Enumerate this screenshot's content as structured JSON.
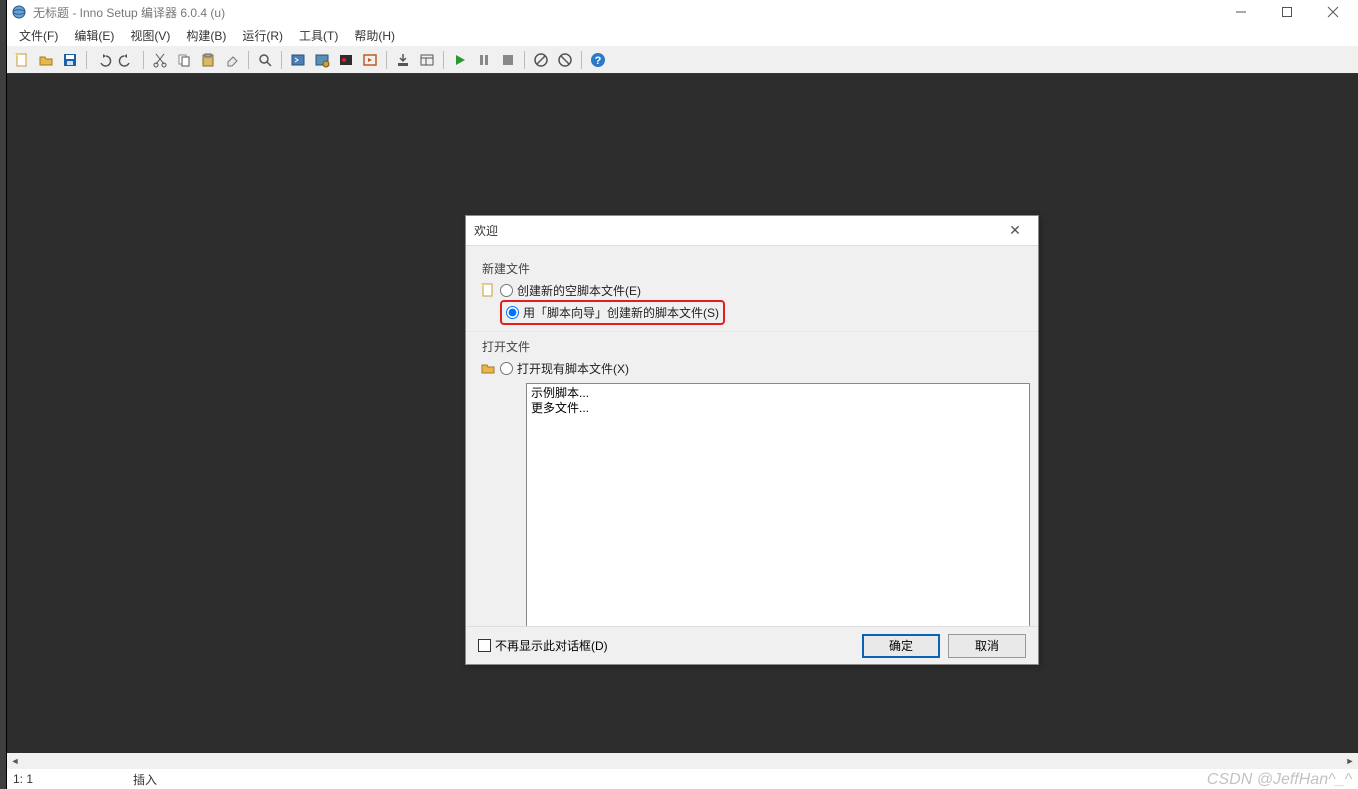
{
  "window": {
    "title": "无标题 - Inno Setup 编译器 6.0.4 (u)"
  },
  "menu": {
    "file": "文件(F)",
    "edit": "编辑(E)",
    "view": "视图(V)",
    "build": "构建(B)",
    "run": "运行(R)",
    "tools": "工具(T)",
    "help": "帮助(H)"
  },
  "status": {
    "position": "1:   1",
    "mode": "插入",
    "watermark": "CSDN @JeffHan^_^"
  },
  "dialog": {
    "title": "欢迎",
    "new_group": "新建文件",
    "opt_empty": "创建新的空脚本文件(E)",
    "opt_wizard": "用「脚本向导」创建新的脚本文件(S)",
    "open_group": "打开文件",
    "opt_open_existing": "打开现有脚本文件(X)",
    "list": {
      "item0": "示例脚本...",
      "item1": "更多文件..."
    },
    "dont_show": "不再显示此对话框(D)",
    "ok": "确定",
    "cancel": "取消"
  }
}
